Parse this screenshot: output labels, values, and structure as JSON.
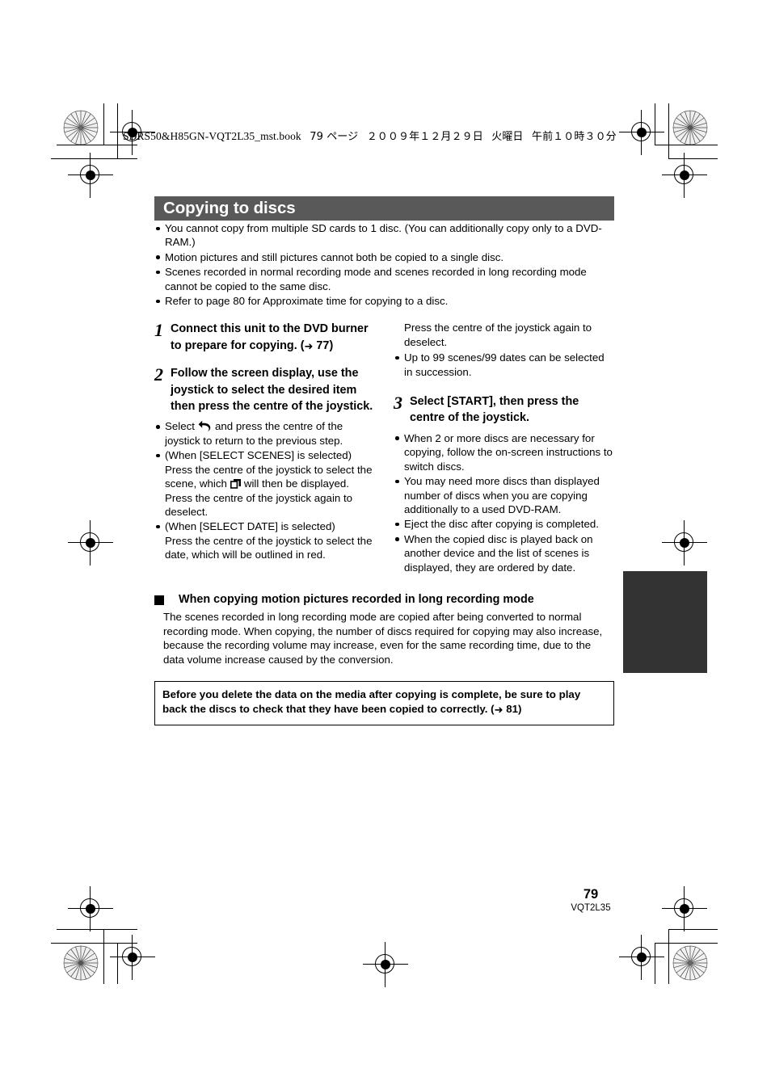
{
  "print_marks": {
    "header_file_line": {
      "book": "SDRS50&H85GN-VQT2L35_mst.book",
      "page_label": "79 ページ",
      "date": "２００９年１２月２９日",
      "weekday": "火曜日",
      "time": "午前１０時３０分"
    },
    "registration_icon": "registration-target-icon",
    "star_icon": "star-target-icon"
  },
  "section": {
    "title": "Copying to discs",
    "title_bg": "#595959",
    "title_color": "#ffffff",
    "intro_bullets": [
      "You cannot copy from multiple SD cards to 1 disc. (You can additionally copy only to a DVD-RAM.)",
      "Motion pictures and still pictures cannot both be copied to a single disc.",
      "Scenes recorded in normal recording mode and scenes recorded in long recording mode cannot be copied to the same disc.",
      "Refer to page 80 for Approximate time for copying to a disc."
    ]
  },
  "steps": {
    "step1": {
      "number": "1",
      "text_a": "Connect this unit to the DVD burner to prepare for copying. (",
      "arrow": "➜",
      "page_ref": "77",
      "text_b": ")"
    },
    "step2": {
      "number": "2",
      "text": "Follow the screen display, use the joystick to select the desired item then press the centre of the joystick."
    },
    "step3": {
      "number": "3",
      "text": "Select [START], then press the centre of the joystick."
    }
  },
  "left_column": {
    "bullet_return": {
      "before_icon": "Select",
      "icon": "return-arrow-icon",
      "after_icon": "and press the centre of the joystick to return to the previous step."
    },
    "bullet_select_scenes": {
      "line1": "(When [SELECT SCENES] is selected)",
      "line2_a": "Press the centre of the joystick to select the scene, which",
      "icon": "copy-pages-icon",
      "line2_b": "will then be displayed. Press the centre of the joystick again to deselect."
    },
    "bullet_select_date": {
      "line1": "(When [SELECT DATE] is selected)",
      "line2": "Press the centre of the joystick to select the date, which will be outlined in red."
    }
  },
  "right_column": {
    "carryover": "Press the centre of the joystick again to deselect.",
    "bullet_succession": "Up to 99 scenes/99 dates can be selected in succession.",
    "step3_bullets": [
      "When 2 or more discs are necessary for copying, follow the on-screen instructions to switch discs.",
      "You may need more discs than displayed number of discs when you are copying additionally to a used DVD-RAM.",
      "Eject the disc after copying is completed.",
      "When the copied disc is played back on another device and the list of scenes is displayed, they are ordered by date."
    ]
  },
  "long_mode_section": {
    "heading": "When copying motion pictures recorded in long recording mode",
    "body": "The scenes recorded in long recording mode are copied after being converted to normal recording mode. When copying, the number of discs required for copying may also increase, because the recording volume may increase, even for the same recording time, due to the data volume increase caused by the conversion."
  },
  "warning_box": {
    "text_a": "Before you delete the data on the media after copying is complete, be sure to play back the discs to check that they have been copied to correctly. (",
    "arrow": "➜",
    "page_ref": "81",
    "text_b": ")"
  },
  "footer": {
    "page_number": "79",
    "doc_code": "VQT2L35"
  }
}
